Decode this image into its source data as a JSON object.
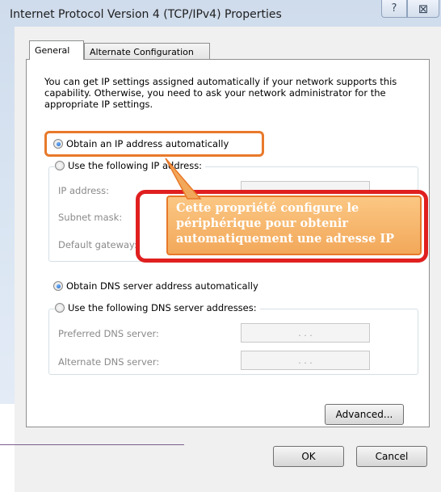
{
  "window": {
    "title": "Internet Protocol Version 4 (TCP/IPv4) Properties",
    "help_glyph": "?",
    "close_glyph": "⊠"
  },
  "tabs": [
    {
      "label": "General"
    },
    {
      "label": "Alternate Configuration"
    }
  ],
  "description": "You can get IP settings assigned automatically if your network supports this capability. Otherwise, you need to ask your network administrator for the appropriate IP settings.",
  "ip": {
    "auto_label": "Obtain an IP address automatically",
    "manual_label": "Use the following IP address:",
    "fields": [
      {
        "label": "IP address:"
      },
      {
        "label": "Subnet mask:"
      },
      {
        "label": "Default gateway:"
      }
    ]
  },
  "dns": {
    "auto_label": "Obtain DNS server address automatically",
    "manual_label": "Use the following DNS server addresses:",
    "fields": [
      {
        "label": "Preferred DNS server:",
        "value": ". . ."
      },
      {
        "label": "Alternate DNS server:",
        "value": ". . ."
      }
    ]
  },
  "callout": {
    "line1": "Cette propriété configure le",
    "line2": "périphérique pour obtenir",
    "line3": "automatiquement une adresse IP"
  },
  "buttons": {
    "advanced": "Advanced...",
    "ok": "OK",
    "cancel": "Cancel"
  },
  "colors": {
    "highlight_orange": "#e8792a",
    "callout_red": "#e01f1f"
  }
}
